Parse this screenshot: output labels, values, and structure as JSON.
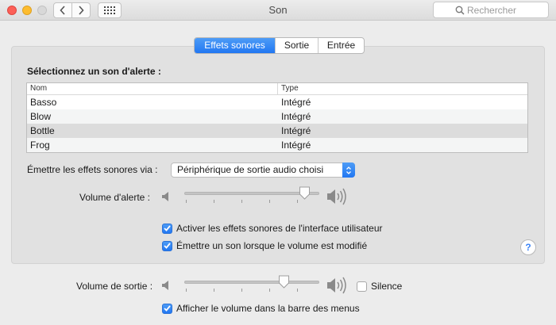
{
  "window": {
    "title": "Son"
  },
  "toolbar": {
    "search_placeholder": "Rechercher"
  },
  "tabs": [
    {
      "label": "Effets sonores",
      "active": true
    },
    {
      "label": "Sortie",
      "active": false
    },
    {
      "label": "Entrée",
      "active": false
    }
  ],
  "effects": {
    "heading": "Sélectionnez un son d'alerte :",
    "columns": {
      "name": "Nom",
      "type": "Type"
    },
    "sounds": [
      {
        "name": "Basso",
        "type": "Intégré"
      },
      {
        "name": "Blow",
        "type": "Intégré"
      },
      {
        "name": "Bottle",
        "type": "Intégré",
        "selected": true
      },
      {
        "name": "Frog",
        "type": "Intégré"
      }
    ],
    "play_via_label": "Émettre les effets sonores via :",
    "play_via_value": "Périphérique de sortie audio choisi",
    "alert_volume_label": "Volume d'alerte :",
    "alert_volume_level": 0.93,
    "ui_effects_label": "Activer les effets sonores de l'interface utilisateur",
    "ui_effects_checked": true,
    "volume_feedback_label": "Émettre un son lorsque le volume est modifié",
    "volume_feedback_checked": true,
    "help_label": "?"
  },
  "output": {
    "volume_label": "Volume de sortie :",
    "volume_level": 0.76,
    "silence_label": "Silence",
    "silence_checked": false,
    "menu_bar_label": "Afficher le volume dans la barre des menus",
    "menu_bar_checked": true
  },
  "colors": {
    "accent": "#2277f2",
    "close": "#fc5f57",
    "minimize": "#fdbc2e"
  }
}
